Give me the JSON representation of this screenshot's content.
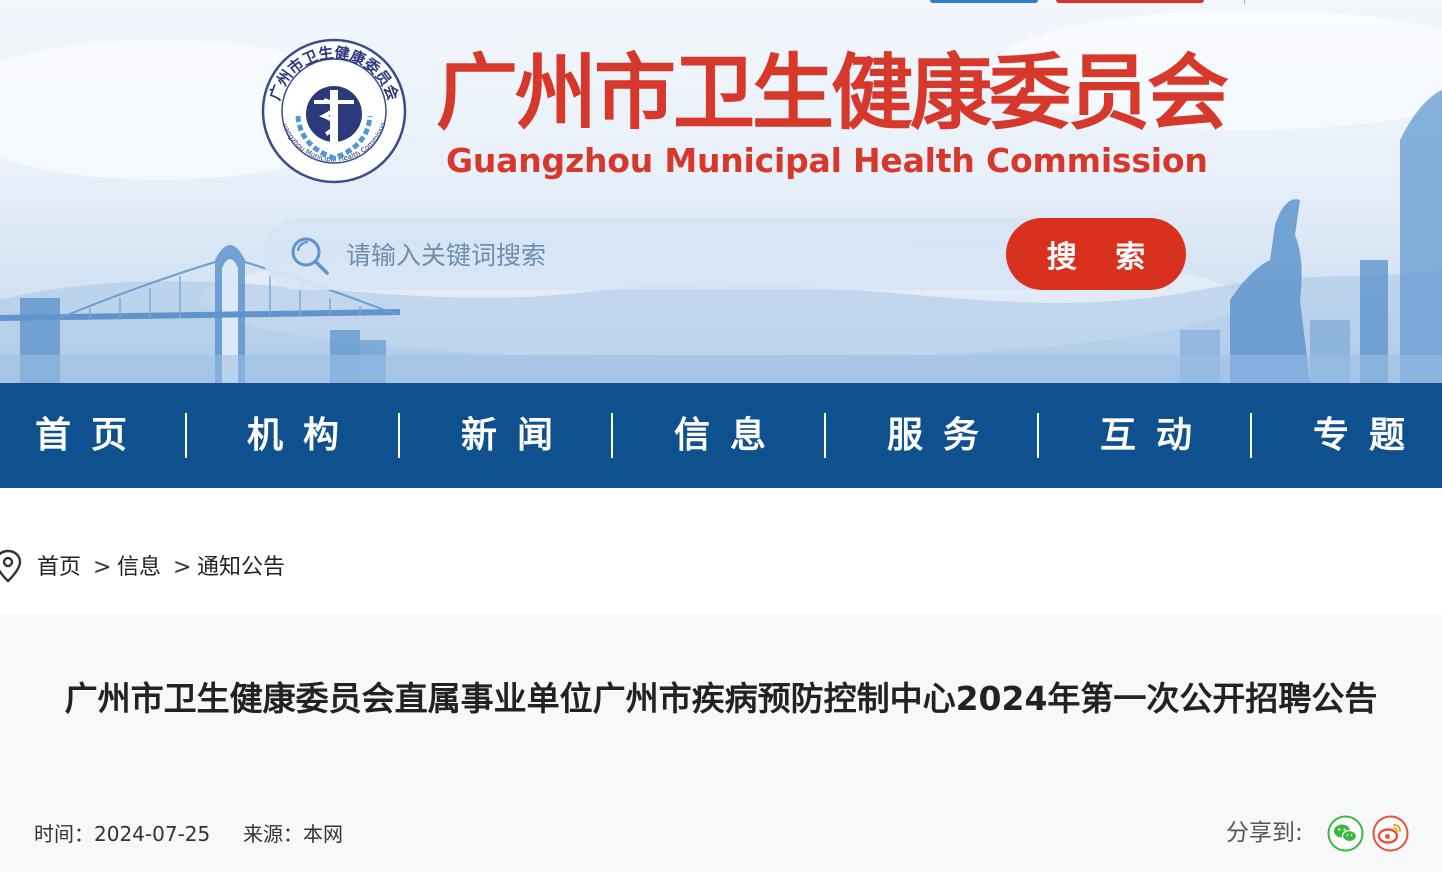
{
  "header": {
    "title_cn": "广州市卫生健康委员会",
    "title_en": "Guangzhou Municipal Health Commission",
    "logo": {
      "ring_text_cn": "广州市卫生健康委员会",
      "ring_text_en": "Guangzhou Municipal Health Commission",
      "icon": "health-emblem-logo"
    },
    "search": {
      "placeholder": "请输入关键词搜索",
      "button_label": "搜 索",
      "icon": "search-icon"
    },
    "colors": {
      "title": "#d6392c",
      "search_button": "#d8321f",
      "nav_bg": "#0f508f"
    }
  },
  "nav": {
    "items": [
      {
        "label": "首页"
      },
      {
        "label": "机构"
      },
      {
        "label": "新闻"
      },
      {
        "label": "信息"
      },
      {
        "label": "服务"
      },
      {
        "label": "互动"
      },
      {
        "label": "专题"
      }
    ]
  },
  "breadcrumb": {
    "icon": "location-pin-icon",
    "items": [
      {
        "label": "首页"
      },
      {
        "label": "信息"
      },
      {
        "label": "通知公告"
      }
    ],
    "separator": ">"
  },
  "article": {
    "title": "广州市卫生健康委员会直属事业单位广州市疾病预防控制中心2024年第一次公开招聘公告",
    "time_label": "时间：",
    "time_value": "2024-07-25",
    "source_label": "来源：",
    "source_value": "本网",
    "share_label": "分享到:",
    "share_targets": [
      {
        "name": "wechat",
        "icon": "wechat-icon",
        "color": "#3bb63f"
      },
      {
        "name": "weibo",
        "icon": "weibo-icon",
        "color": "#e8523f"
      }
    ]
  }
}
